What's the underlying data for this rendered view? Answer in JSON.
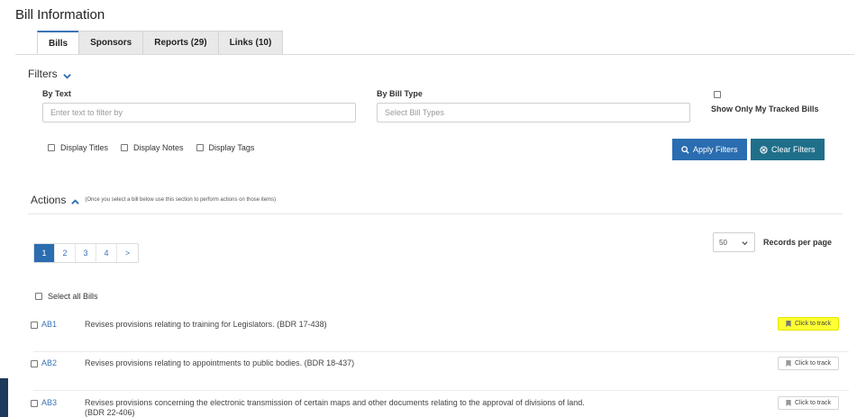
{
  "header": {
    "title": "Bill Information"
  },
  "tabs": [
    {
      "label": "Bills",
      "active": true
    },
    {
      "label": "Sponsors"
    },
    {
      "label": "Reports (29)"
    },
    {
      "label": "Links (10)"
    }
  ],
  "filters": {
    "heading": "Filters",
    "by_text_label": "By Text",
    "by_text_placeholder": "Enter text to filter by",
    "by_type_label": "By Bill Type",
    "by_type_placeholder": "Select Bill Types",
    "tracked_label": "Show Only My Tracked Bills",
    "display_titles": "Display Titles",
    "display_notes": "Display Notes",
    "display_tags": "Display Tags",
    "apply_label": "Apply Filters",
    "clear_label": "Clear Filters"
  },
  "actions": {
    "heading": "Actions",
    "note": "(Once you select a bill below use this section to perform actions on those items)"
  },
  "pagination": {
    "pages": [
      "1",
      "2",
      "3",
      "4",
      ">"
    ],
    "current": "1"
  },
  "records": {
    "value": "50",
    "label": "Records per page"
  },
  "select_all_label": "Select all Bills",
  "bills": [
    {
      "id": "AB1",
      "description": "Revises provisions relating to training for Legislators. (BDR 17-438)",
      "track_label": "Click to track"
    },
    {
      "id": "AB2",
      "description": "Revises provisions relating to appointments to public bodies. (BDR 18-437)",
      "track_label": "Click to track"
    },
    {
      "id": "AB3",
      "description": "Revises provisions concerning the electronic transmission of certain maps and other documents relating to the approval of divisions of land. (BDR 22-406)",
      "track_label": "Click to track"
    }
  ],
  "colors": {
    "accent": "#2a6db0",
    "clear_button": "#1f6f8b",
    "highlight": "#ffff33"
  }
}
